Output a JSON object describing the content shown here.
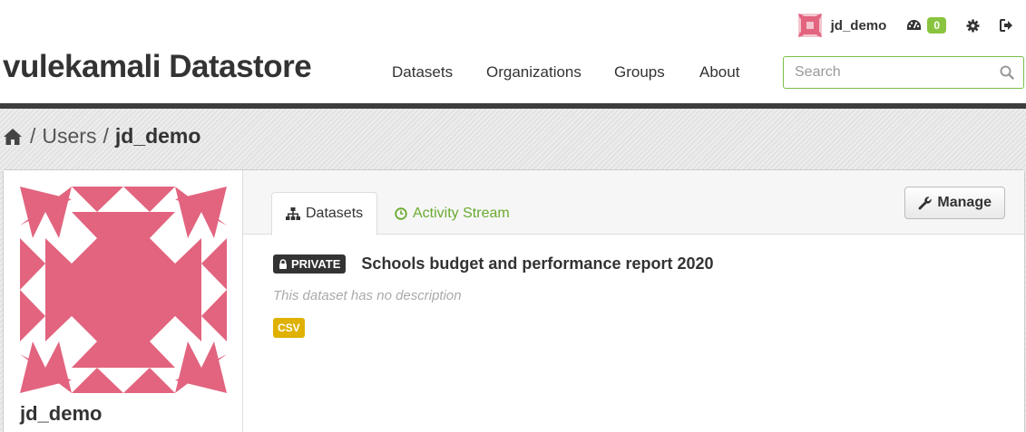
{
  "account": {
    "username": "jd_demo",
    "dashboard_count": "0"
  },
  "site": {
    "title": "vulekamali Datastore"
  },
  "nav": {
    "items": [
      {
        "label": "Datasets"
      },
      {
        "label": "Organizations"
      },
      {
        "label": "Groups"
      },
      {
        "label": "About"
      }
    ]
  },
  "search": {
    "placeholder": "Search"
  },
  "breadcrumb": {
    "users": "Users",
    "current": "jd_demo"
  },
  "profile": {
    "name": "jd_demo",
    "avatar_color": "#e2647f"
  },
  "tabs": [
    {
      "label": "Datasets",
      "icon": "sitemap-icon"
    },
    {
      "label": "Activity Stream",
      "icon": "clock-icon"
    }
  ],
  "manage_label": "Manage",
  "dataset": {
    "badge": "PRIVATE",
    "title": "Schools budget and performance report 2020",
    "description": "This dataset has no description",
    "format": "CSV"
  },
  "colors": {
    "accent_green": "#6aaa2e",
    "badge_green": "#8ac43f",
    "format_yellow": "#dfb100"
  }
}
